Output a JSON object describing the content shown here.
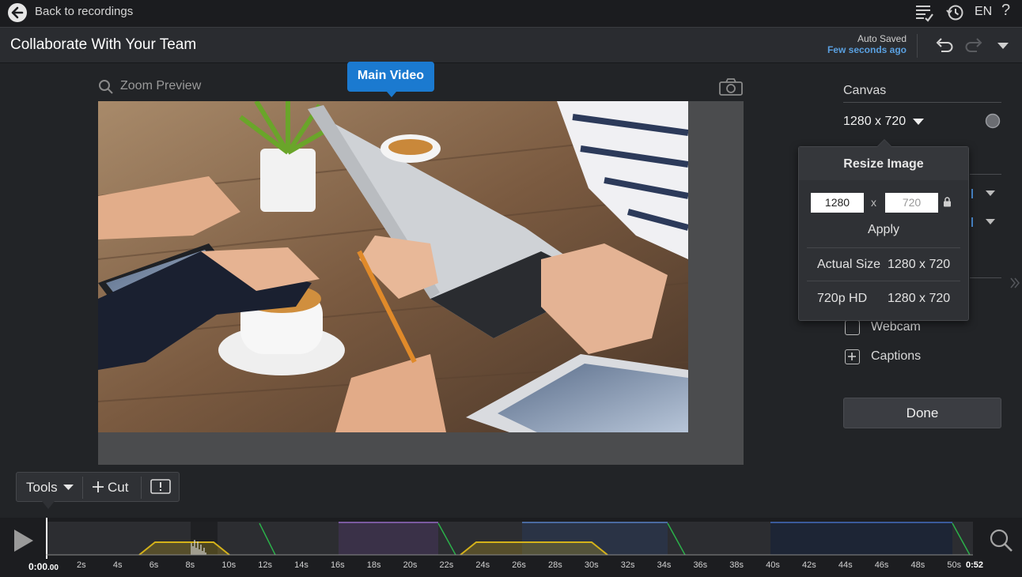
{
  "topbar": {
    "back_label": "Back to recordings",
    "language": "EN",
    "help_symbol": "?",
    "icons": [
      "back-arrow-icon",
      "checklist-icon",
      "history-icon",
      "help-icon"
    ]
  },
  "header": {
    "title": "Collaborate With Your Team",
    "autosave_label": "Auto Saved",
    "autosave_time": "Few seconds ago",
    "icons": [
      "undo-icon",
      "redo-icon",
      "caret-down-icon"
    ]
  },
  "preview": {
    "zoom_label": "Zoom Preview",
    "badge_label": "Main Video",
    "icons": [
      "search-icon",
      "camera-icon"
    ]
  },
  "right_panel": {
    "canvas_label": "Canvas",
    "canvas_size": "1280 x 720",
    "webcam_label": "Webcam",
    "captions_label": "Captions",
    "done_label": "Done"
  },
  "resize_popup": {
    "title": "Resize Image",
    "width_value": "1280",
    "height_value": "720",
    "times": "x",
    "apply_label": "Apply",
    "options": [
      {
        "name": "Actual Size",
        "size": "1280 x 720"
      },
      {
        "name": "720p HD",
        "size": "1280 x 720"
      }
    ]
  },
  "tools_bar": {
    "tools_label": "Tools",
    "cut_label": "Cut",
    "icons": [
      "plus-icon",
      "alert-icon"
    ]
  },
  "timeline": {
    "current_time": "0:00",
    "current_time_frac": ".00",
    "end_time": "0:52",
    "ticks": [
      "2s",
      "4s",
      "6s",
      "8s",
      "10s",
      "12s",
      "14s",
      "16s",
      "18s",
      "20s",
      "22s",
      "24s",
      "26s",
      "28s",
      "30s",
      "32s",
      "34s",
      "36s",
      "38s",
      "40s",
      "42s",
      "44s",
      "46s",
      "48s",
      "50s"
    ],
    "colors": {
      "purple": "#4a3a5c",
      "blue": "#2a3a55",
      "yellow": "#d4b21a",
      "green": "#2bb04a"
    }
  }
}
